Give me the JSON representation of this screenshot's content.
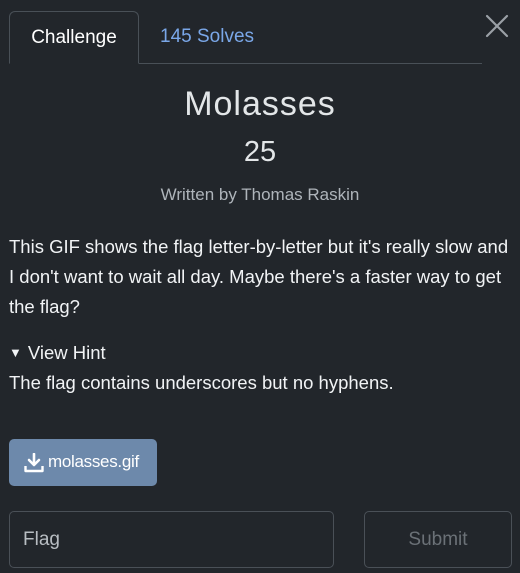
{
  "tabs": {
    "challenge_label": "Challenge",
    "solves_label": "145 Solves"
  },
  "challenge": {
    "name": "Molasses",
    "points": "25",
    "author": "Written by Thomas Raskin",
    "description": "This GIF shows the flag letter-by-letter but it's really slow and I don't want to wait all day. Maybe there's a faster way to get the flag?"
  },
  "hint": {
    "toggle_icon": "▼",
    "toggle_label": "View Hint",
    "text": "The flag contains underscores but no hyphens."
  },
  "attachment": {
    "icon": "download-icon",
    "filename": "molasses.gif"
  },
  "form": {
    "flag_placeholder": "Flag",
    "submit_label": "Submit"
  },
  "colors": {
    "background": "#22262b",
    "accent_link": "#7aa7e8",
    "file_button": "#6d89ab"
  }
}
